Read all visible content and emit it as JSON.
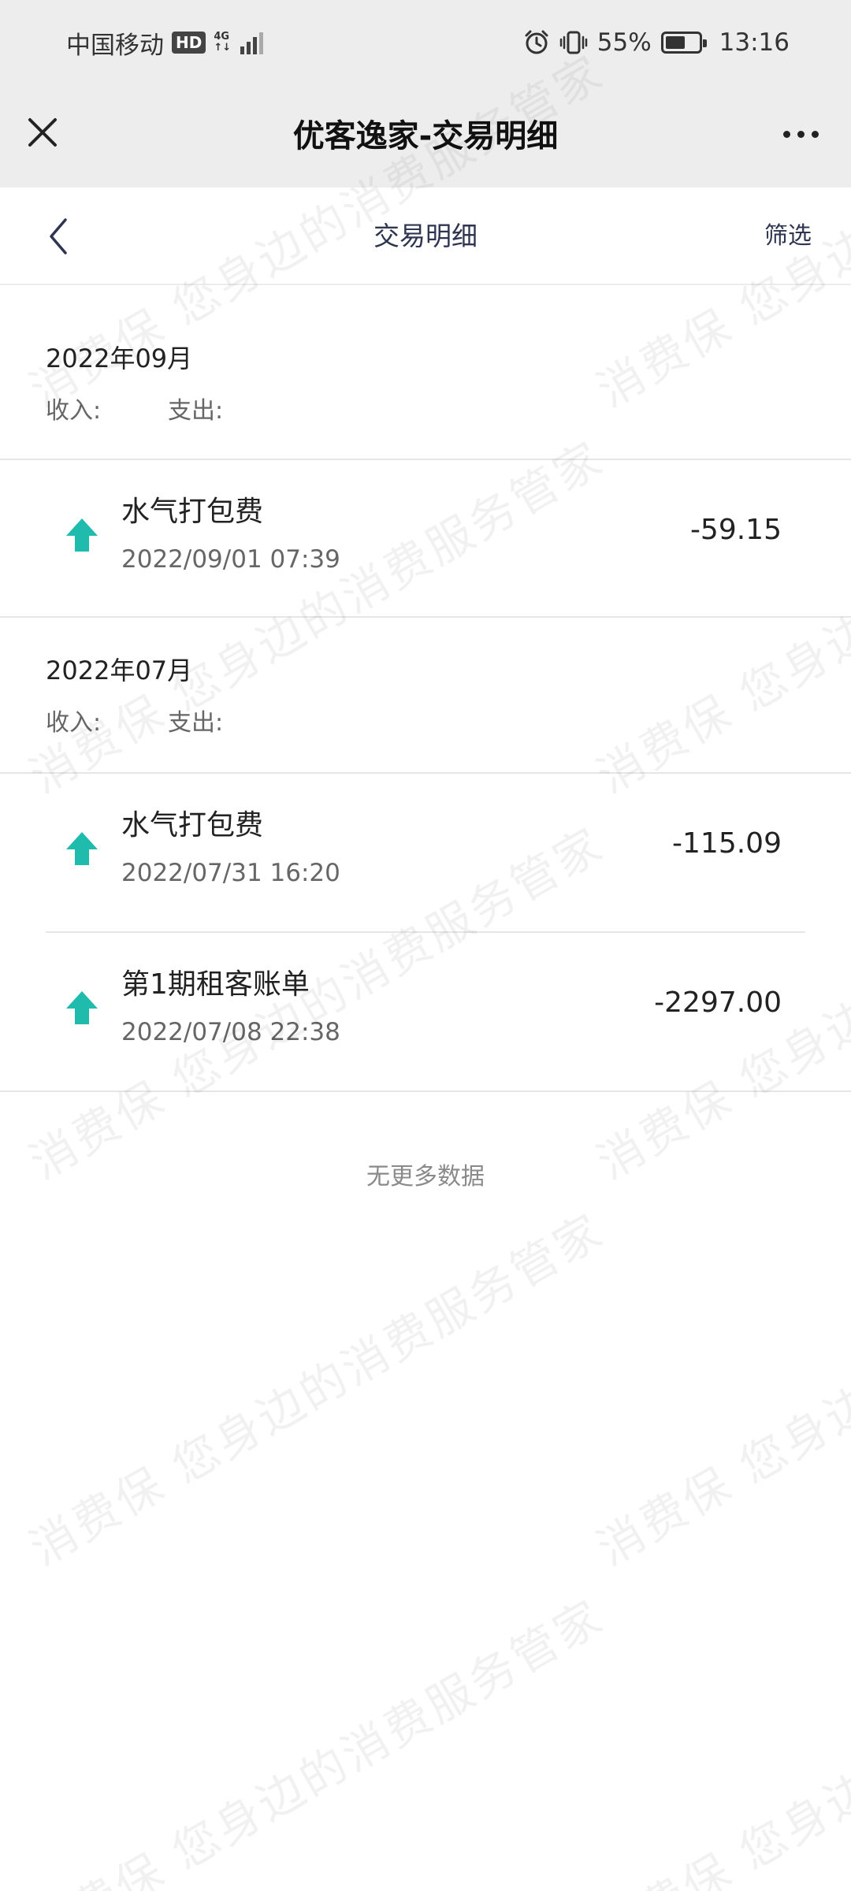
{
  "status_bar": {
    "carrier": "中国移动",
    "hd": "HD",
    "network_top": "4G",
    "network_bottom": "↑↓",
    "battery": "55%",
    "time": "13:16"
  },
  "title_bar": {
    "title": "优客逸家-交易明细"
  },
  "page_header": {
    "title": "交易明细",
    "filter_label": "筛选"
  },
  "months": [
    {
      "title": "2022年09月",
      "income_label": "收入:",
      "expense_label": "支出:",
      "transactions": [
        {
          "name": "水气打包费",
          "time": "2022/09/01 07:39",
          "amount": "-59.15"
        }
      ]
    },
    {
      "title": "2022年07月",
      "income_label": "收入:",
      "expense_label": "支出:",
      "transactions": [
        {
          "name": "水气打包费",
          "time": "2022/07/31 16:20",
          "amount": "-115.09"
        },
        {
          "name": "第1期租客账单",
          "time": "2022/07/08 22:38",
          "amount": "-2297.00"
        }
      ]
    }
  ],
  "footer": {
    "no_more": "无更多数据"
  },
  "watermark": {
    "text_a": "消费保 您身边的消费服务管家",
    "text_b": "消费保 您身边的消费服务管家"
  },
  "colors": {
    "arrow": "#1fbcae",
    "title_bar_bg": "#ededed",
    "page_title": "#2e3550"
  },
  "icons": {
    "close": "close-icon",
    "more": "more-icon",
    "back": "back-chevron-icon",
    "arrow": "arrow-up-icon"
  }
}
